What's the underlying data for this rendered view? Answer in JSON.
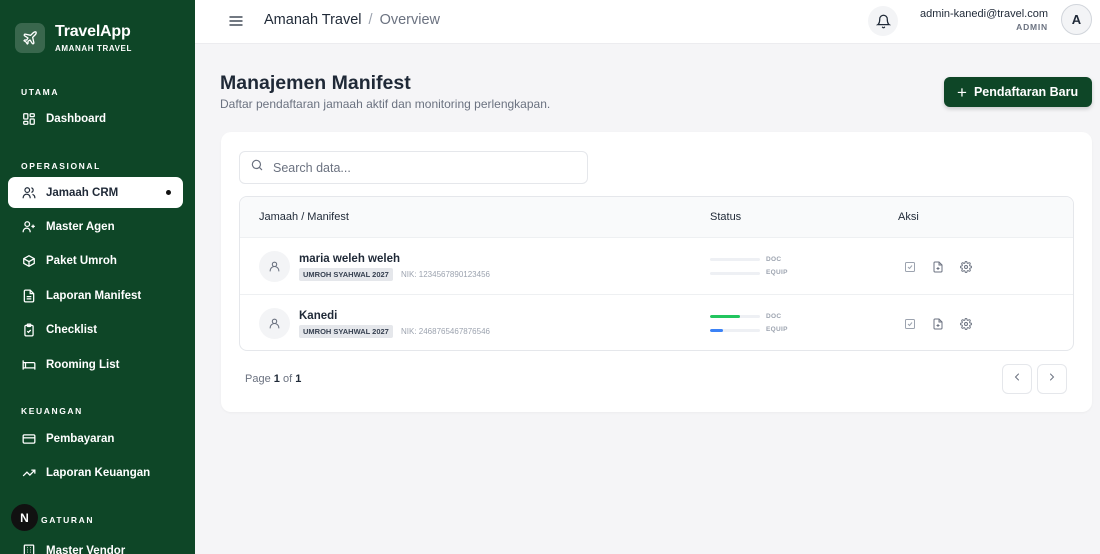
{
  "brand": {
    "name": "TravelApp",
    "subtitle": "AMANAH TRAVEL"
  },
  "sidebar": {
    "sections": [
      {
        "label": "UTAMA"
      },
      {
        "label": "OPERASIONAL"
      },
      {
        "label": "KEUANGAN"
      },
      {
        "label": "GATURAN"
      }
    ],
    "items": [
      {
        "label": "Dashboard",
        "icon": "dashboard-icon"
      },
      {
        "label": "Jamaah CRM",
        "icon": "users-icon",
        "active": true
      },
      {
        "label": "Master Agen",
        "icon": "user-plus-icon"
      },
      {
        "label": "Paket Umroh",
        "icon": "package-icon"
      },
      {
        "label": "Laporan Manifest",
        "icon": "file-text-icon"
      },
      {
        "label": "Checklist",
        "icon": "clipboard-check-icon"
      },
      {
        "label": "Rooming List",
        "icon": "bed-icon"
      },
      {
        "label": "Pembayaran",
        "icon": "credit-card-icon"
      },
      {
        "label": "Laporan Keuangan",
        "icon": "trending-up-icon"
      },
      {
        "label": "Master Vendor",
        "icon": "building-icon"
      }
    ],
    "badge": "N"
  },
  "topbar": {
    "breadcrumb_root": "Amanah Travel",
    "breadcrumb_sep": "/",
    "breadcrumb_current": "Overview",
    "user_email": "admin-kanedi@travel.com",
    "user_role": "ADMIN",
    "avatar_initial": "A"
  },
  "main": {
    "title": "Manajemen Manifest",
    "subtitle": "Daftar pendaftaran jamaah aktif dan monitoring perlengkapan.",
    "add_button": "Pendaftaran Baru",
    "add_button_plus": "+",
    "search_placeholder": "Search data...",
    "columns": [
      "Jamaah / Manifest",
      "Status",
      "Aksi"
    ],
    "rows": [
      {
        "name": "maria weleh weleh",
        "package": "UMROH SYAHWAL 2027",
        "nik": "NIK: 1234567890123456",
        "doc_label": "DOC",
        "equip_label": "EQUIP",
        "doc_progress": 0,
        "equip_progress": 0
      },
      {
        "name": "Kanedi",
        "package": "UMROH SYAHWAL 2027",
        "nik": "NIK: 2468765467876546",
        "doc_label": "DOC",
        "equip_label": "EQUIP",
        "doc_progress": 0.6,
        "equip_progress": 0.25
      }
    ],
    "pager": {
      "prefix": "Page",
      "current": "1",
      "of": "of",
      "total": "1"
    }
  },
  "colors": {
    "sidebar_bg": "#0e4627",
    "doc_bar": "#22c55e",
    "equip_bar": "#3b82f6"
  }
}
